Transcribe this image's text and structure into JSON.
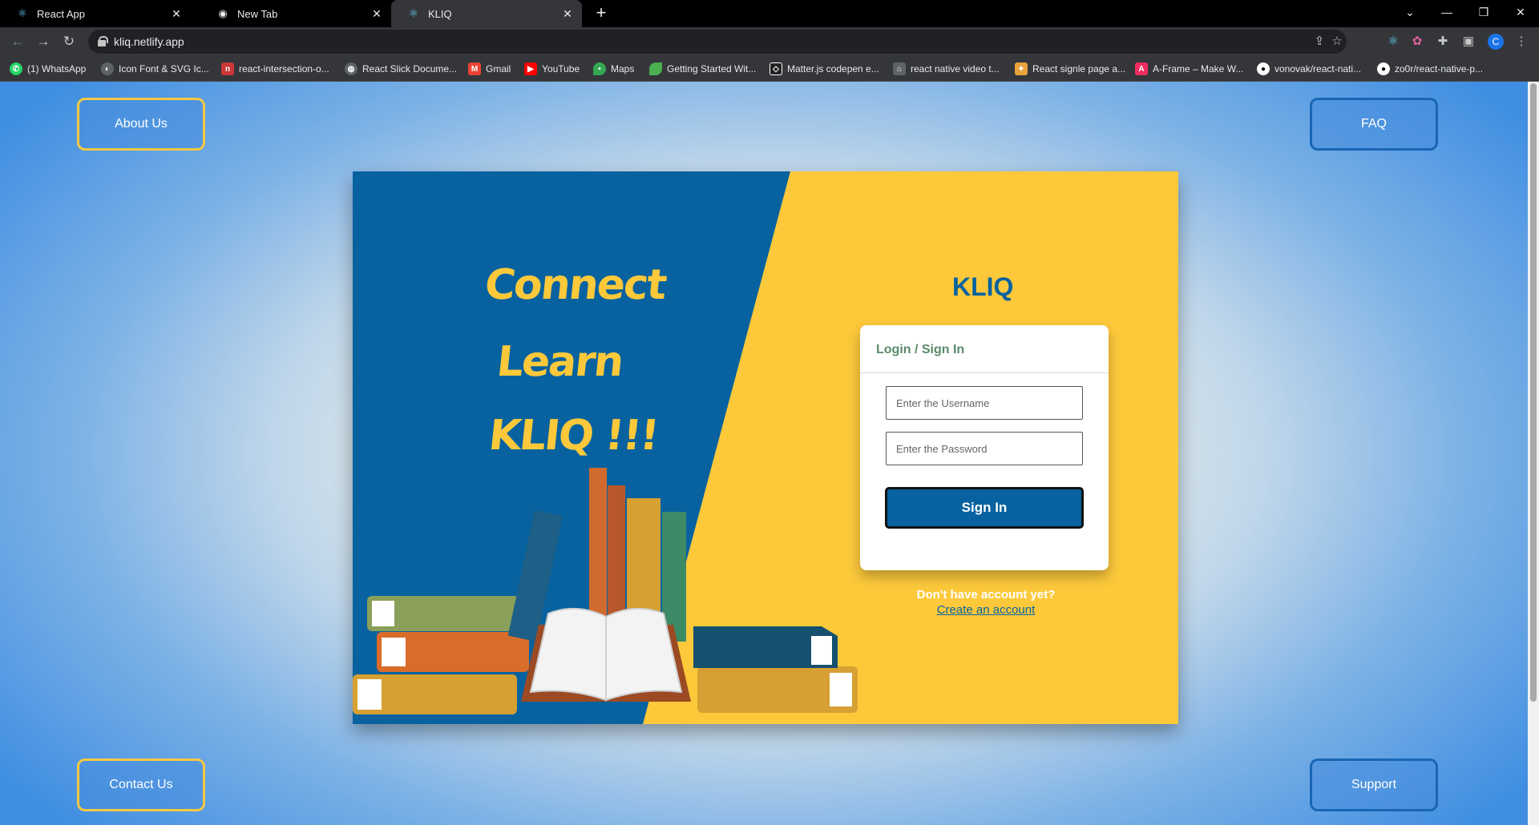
{
  "browser": {
    "tabs": [
      {
        "title": "React App",
        "icon": "react-icon"
      },
      {
        "title": "New Tab",
        "icon": "chrome-icon"
      },
      {
        "title": "KLIQ",
        "icon": "react-icon",
        "active": true
      }
    ],
    "url": "kliq.netlify.app",
    "profile_initial": "C",
    "bookmarks": [
      {
        "label": "(1) WhatsApp",
        "icon": "whatsapp-icon",
        "color": "#25d366"
      },
      {
        "label": "Icon Font & SVG Ic...",
        "icon": "iconfont-icon",
        "color": "#5f6368"
      },
      {
        "label": "react-intersection-o...",
        "icon": "npm-icon",
        "color": "#cb3837"
      },
      {
        "label": "React Slick Docume...",
        "icon": "globe-icon",
        "color": "#5f6368"
      },
      {
        "label": "Gmail",
        "icon": "gmail-icon",
        "color": "#ea4335"
      },
      {
        "label": "YouTube",
        "icon": "youtube-icon",
        "color": "#ff0000"
      },
      {
        "label": "Maps",
        "icon": "maps-icon",
        "color": "#34a853"
      },
      {
        "label": "Getting Started Wit...",
        "icon": "leaf-icon",
        "color": "#4caf50"
      },
      {
        "label": "Matter.js codepen e...",
        "icon": "codepen-icon",
        "color": "#ffffff"
      },
      {
        "label": "react native video t...",
        "icon": "expo-icon",
        "color": "#5f6368"
      },
      {
        "label": "React signle page a...",
        "icon": "brand-icon",
        "color": "#e8a33d"
      },
      {
        "label": "A-Frame – Make W...",
        "icon": "aframe-icon",
        "color": "#ef2d5e"
      },
      {
        "label": "vonovak/react-nati...",
        "icon": "github-icon",
        "color": "#ffffff"
      },
      {
        "label": "zo0r/react-native-p...",
        "icon": "github-icon",
        "color": "#ffffff"
      }
    ]
  },
  "page": {
    "about_label": "About Us",
    "faq_label": "FAQ",
    "contact_label": "Contact Us",
    "support_label": "Support",
    "slogan": [
      "Connect",
      "Learn",
      "KLIQ !!!"
    ],
    "brand": "KLIQ",
    "login": {
      "header": "Login / Sign In",
      "username_placeholder": "Enter the Username",
      "password_placeholder": "Enter the Password",
      "signin_label": "Sign In"
    },
    "no_account": "Don't have account yet?",
    "create_account": "Create an account"
  },
  "colors": {
    "brand_blue": "#07629f",
    "brand_yellow": "#fdc93b"
  }
}
